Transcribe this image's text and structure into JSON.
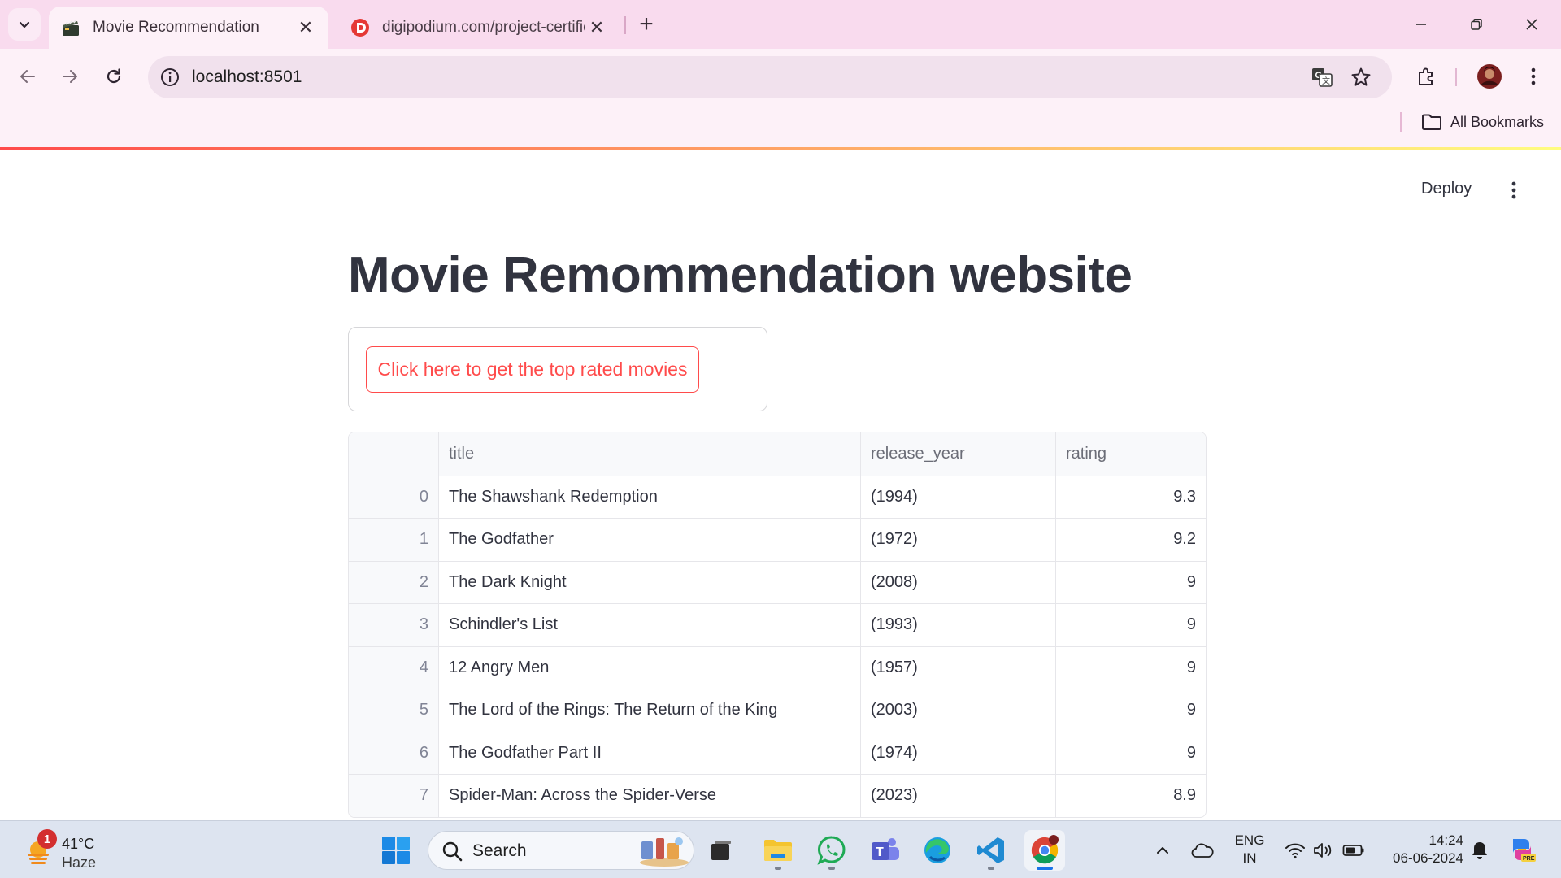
{
  "browser": {
    "tabs": [
      {
        "title": "Movie Recommendation",
        "active": true,
        "favicon": "clapperboard-icon"
      },
      {
        "title": "digipodium.com/project-certific",
        "active": false,
        "favicon": "digipodium-icon"
      }
    ],
    "address": "localhost:8501",
    "bookmarks_label": "All Bookmarks"
  },
  "app": {
    "deploy_label": "Deploy",
    "title": "Movie Remommendation website",
    "top_rated_button": "Click here to get the top rated movies",
    "accent_color": "#ff4b4b"
  },
  "table": {
    "columns": [
      "",
      "title",
      "release_year",
      "rating"
    ],
    "rows": [
      {
        "index": "0",
        "title": "The Shawshank Redemption",
        "release_year": "(1994)",
        "rating": "9.3"
      },
      {
        "index": "1",
        "title": "The Godfather",
        "release_year": "(1972)",
        "rating": "9.2"
      },
      {
        "index": "2",
        "title": "The Dark Knight",
        "release_year": "(2008)",
        "rating": "9"
      },
      {
        "index": "3",
        "title": "Schindler's List",
        "release_year": "(1993)",
        "rating": "9"
      },
      {
        "index": "4",
        "title": "12 Angry Men",
        "release_year": "(1957)",
        "rating": "9"
      },
      {
        "index": "5",
        "title": "The Lord of the Rings: The Return of the King",
        "release_year": "(2003)",
        "rating": "9"
      },
      {
        "index": "6",
        "title": "The Godfather Part II",
        "release_year": "(1974)",
        "rating": "9"
      },
      {
        "index": "7",
        "title": "Spider-Man: Across the Spider-Verse",
        "release_year": "(2023)",
        "rating": "8.9"
      }
    ]
  },
  "taskbar": {
    "weather_temp": "41°C",
    "weather_condition": "Haze",
    "weather_badge": "1",
    "search_label": "Search",
    "lang_line1": "ENG",
    "lang_line2": "IN",
    "time": "14:24",
    "date": "06-06-2024"
  }
}
